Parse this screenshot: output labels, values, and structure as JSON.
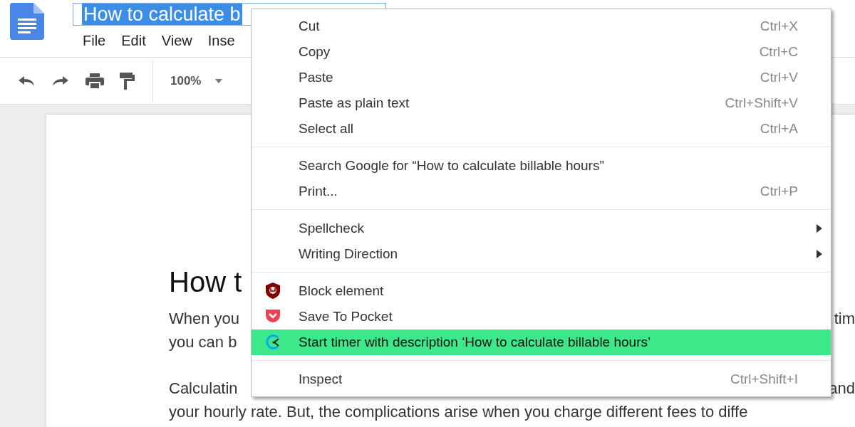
{
  "document_title": "How to calculate b",
  "menu_bar": [
    "File",
    "Edit",
    "View",
    "Inse"
  ],
  "toolbar": {
    "zoom": "100%"
  },
  "document": {
    "heading": "How t",
    "paragraphs": [
      [
        {
          "left": "When you",
          "right": "tim"
        },
        {
          "left": "you can b"
        }
      ],
      [
        {
          "left": "Calculatin",
          "right": "and"
        },
        {
          "left": "your hourly rate. But, the complications arise when you charge different fees to diffe"
        }
      ]
    ]
  },
  "context_menu": {
    "items": [
      {
        "kind": "item",
        "label": "Cut",
        "shortcut": "Ctrl+X",
        "submenu": false,
        "selected": false
      },
      {
        "kind": "item",
        "label": "Copy",
        "shortcut": "Ctrl+C",
        "submenu": false,
        "selected": false
      },
      {
        "kind": "item",
        "label": "Paste",
        "shortcut": "Ctrl+V",
        "submenu": false,
        "selected": false
      },
      {
        "kind": "item",
        "label": "Paste as plain text",
        "shortcut": "Ctrl+Shift+V",
        "submenu": false,
        "selected": false
      },
      {
        "kind": "item",
        "label": "Select all",
        "shortcut": "Ctrl+A",
        "submenu": false,
        "selected": false
      },
      {
        "kind": "separator"
      },
      {
        "kind": "item",
        "label": "Search Google for “How to calculate billable hours”",
        "submenu": false,
        "selected": false
      },
      {
        "kind": "item",
        "label": "Print...",
        "shortcut": "Ctrl+P",
        "submenu": false,
        "selected": false
      },
      {
        "kind": "separator"
      },
      {
        "kind": "item",
        "label": "Spellcheck",
        "submenu": true,
        "selected": false
      },
      {
        "kind": "item",
        "label": "Writing Direction",
        "submenu": true,
        "selected": false
      },
      {
        "kind": "separator"
      },
      {
        "kind": "shield",
        "label": "Block element",
        "submenu": false,
        "selected": false
      },
      {
        "kind": "pocket",
        "label": "Save To Pocket",
        "submenu": false,
        "selected": false
      },
      {
        "kind": "timer",
        "label": "Start timer with description ‘How to calculate billable hours’",
        "submenu": false,
        "selected": true
      },
      {
        "kind": "separator"
      },
      {
        "kind": "item",
        "label": "Inspect",
        "shortcut": "Ctrl+Shift+I",
        "submenu": false,
        "selected": false
      }
    ]
  }
}
